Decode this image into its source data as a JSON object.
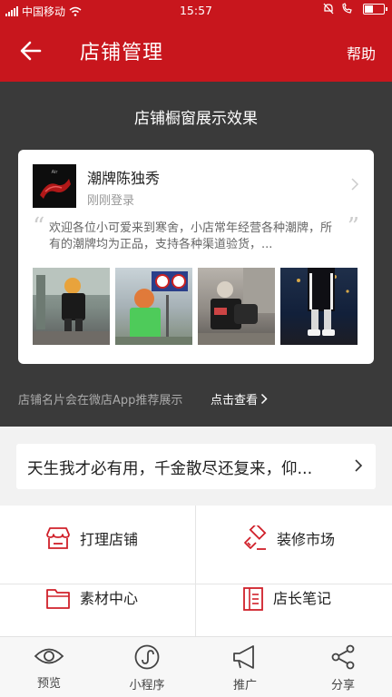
{
  "status_bar": {
    "carrier": "中国移动",
    "time": "15:57"
  },
  "navbar": {
    "title": "店铺管理",
    "help_label": "帮助"
  },
  "preview": {
    "heading": "店铺橱窗展示效果",
    "card": {
      "store_name": "潮牌陈独秀",
      "login_status": "刚刚登录",
      "description": "欢迎各位小可爱来到寒舍，小店常年经营各种潮牌，所有的潮牌均为正品，支持各种渠道验货，..."
    },
    "footnote": "店铺名片会在微店App推荐展示",
    "view_link": "点击查看"
  },
  "slogan": {
    "text": "天生我才必有用，千金散尽还复来，仰..."
  },
  "grid": {
    "items": [
      {
        "label": "打理店铺",
        "icon": "store-icon"
      },
      {
        "label": "装修市场",
        "icon": "brush-icon"
      },
      {
        "label": "素材中心",
        "icon": "folder-icon"
      },
      {
        "label": "店长笔记",
        "icon": "notebook-icon"
      }
    ]
  },
  "tabbar": {
    "items": [
      {
        "label": "预览",
        "icon": "eye-icon"
      },
      {
        "label": "小程序",
        "icon": "mini-program-icon"
      },
      {
        "label": "推广",
        "icon": "megaphone-icon"
      },
      {
        "label": "分享",
        "icon": "share-icon"
      }
    ]
  },
  "colors": {
    "brand_red": "#c8161d",
    "preview_bg": "#3a3a3a"
  }
}
